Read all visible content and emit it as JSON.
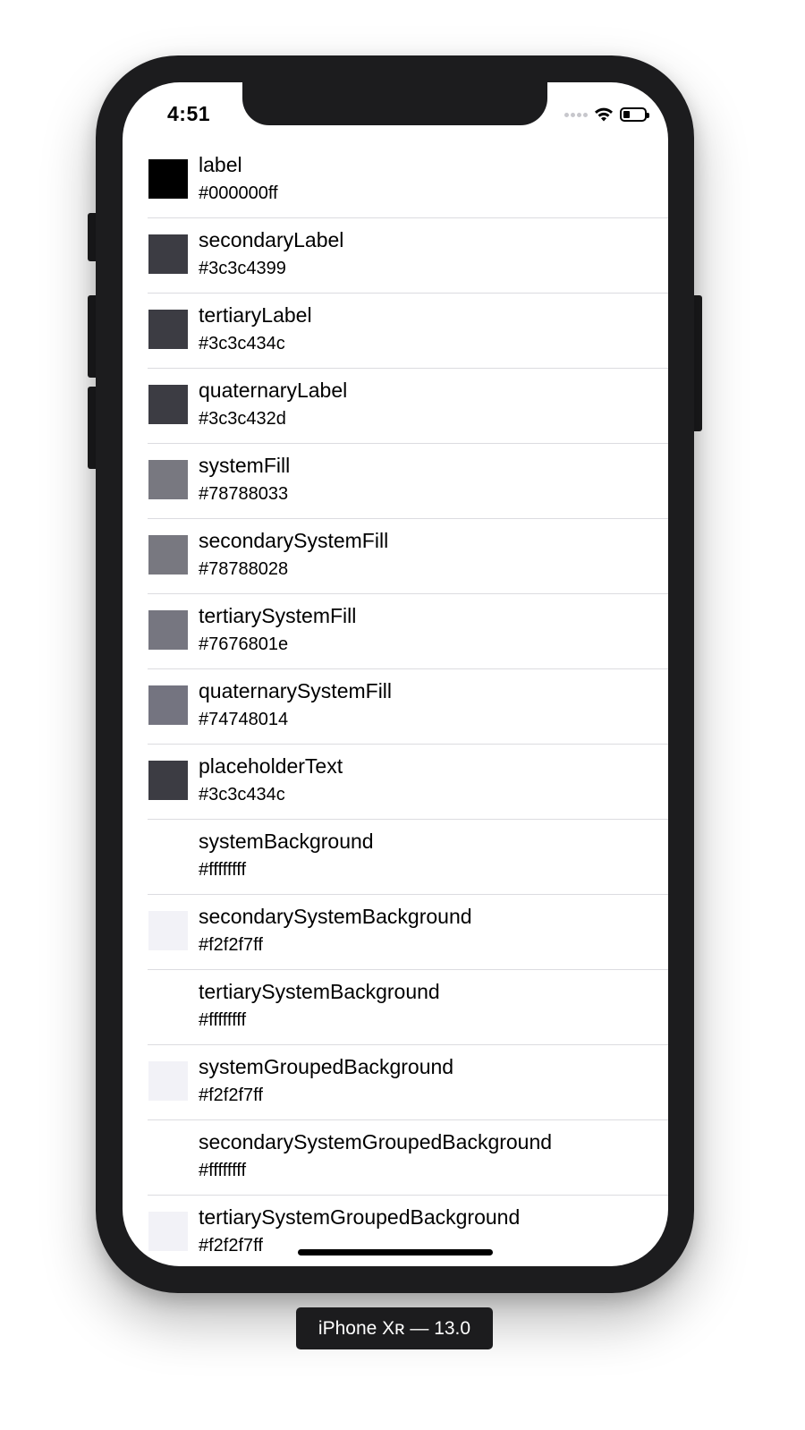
{
  "status_bar": {
    "time": "4:51",
    "signal_icon": "signal-dots-icon",
    "wifi_icon": "wifi-icon",
    "battery_icon": "battery-icon"
  },
  "device_label": "iPhone Xʀ — 13.0",
  "colors": [
    {
      "name": "label",
      "hex": "#000000ff",
      "swatch": "#000000"
    },
    {
      "name": "secondaryLabel",
      "hex": "#3c3c4399",
      "swatch": "#3c3c43"
    },
    {
      "name": "tertiaryLabel",
      "hex": "#3c3c434c",
      "swatch": "#3c3c43"
    },
    {
      "name": "quaternaryLabel",
      "hex": "#3c3c432d",
      "swatch": "#3c3c43"
    },
    {
      "name": "systemFill",
      "hex": "#78788033",
      "swatch": "#787880"
    },
    {
      "name": "secondarySystemFill",
      "hex": "#78788028",
      "swatch": "#787880"
    },
    {
      "name": "tertiarySystemFill",
      "hex": "#7676801e",
      "swatch": "#767680"
    },
    {
      "name": "quaternarySystemFill",
      "hex": "#74748014",
      "swatch": "#747480"
    },
    {
      "name": "placeholderText",
      "hex": "#3c3c434c",
      "swatch": "#3c3c43"
    },
    {
      "name": "systemBackground",
      "hex": "#ffffffff",
      "swatch": "#ffffff"
    },
    {
      "name": "secondarySystemBackground",
      "hex": "#f2f2f7ff",
      "swatch": "#f2f2f7"
    },
    {
      "name": "tertiarySystemBackground",
      "hex": "#ffffffff",
      "swatch": "#ffffff"
    },
    {
      "name": "systemGroupedBackground",
      "hex": "#f2f2f7ff",
      "swatch": "#f2f2f7"
    },
    {
      "name": "secondarySystemGroupedBackground",
      "hex": "#ffffffff",
      "swatch": "#ffffff"
    },
    {
      "name": "tertiarySystemGroupedBackground",
      "hex": "#f2f2f7ff",
      "swatch": "#f2f2f7"
    }
  ]
}
